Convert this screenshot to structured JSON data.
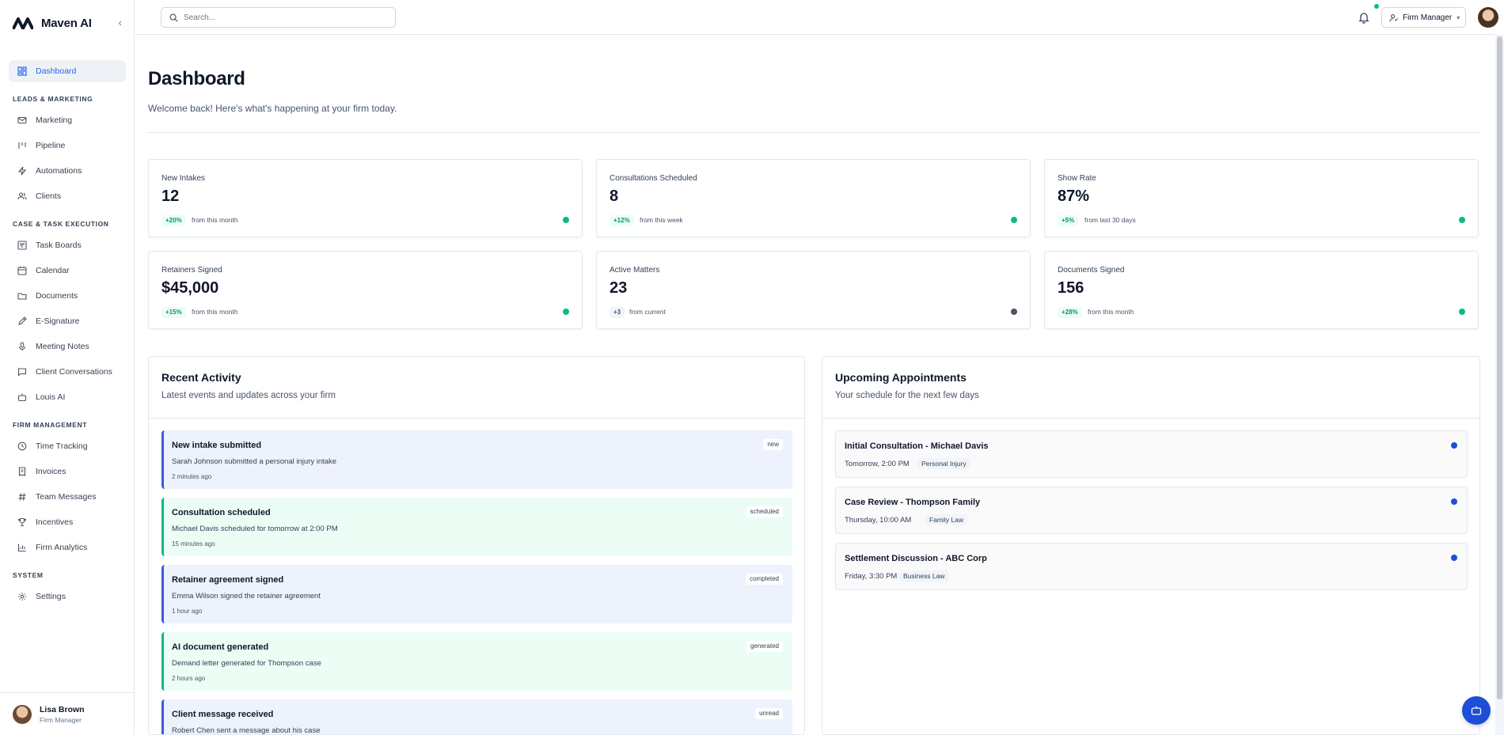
{
  "brand": {
    "name": "Maven AI",
    "collapse_icon": "chevron-left-icon"
  },
  "sidebar": {
    "dashboard": {
      "label": "Dashboard",
      "icon": "layout-grid-icon"
    },
    "sections": [
      {
        "title": "LEADS & MARKETING",
        "items": [
          {
            "label": "Marketing",
            "icon": "mail-icon"
          },
          {
            "label": "Pipeline",
            "icon": "pipeline-icon"
          },
          {
            "label": "Automations",
            "icon": "zap-icon"
          },
          {
            "label": "Clients",
            "icon": "users-icon"
          }
        ]
      },
      {
        "title": "CASE & TASK EXECUTION",
        "items": [
          {
            "label": "Task Boards",
            "icon": "kanban-icon"
          },
          {
            "label": "Calendar",
            "icon": "calendar-icon"
          },
          {
            "label": "Documents",
            "icon": "folder-icon"
          },
          {
            "label": "E-Signature",
            "icon": "pen-icon"
          },
          {
            "label": "Meeting Notes",
            "icon": "mic-icon"
          },
          {
            "label": "Client Conversations",
            "icon": "message-icon"
          },
          {
            "label": "Louis AI",
            "icon": "bot-icon"
          }
        ]
      },
      {
        "title": "FIRM MANAGEMENT",
        "items": [
          {
            "label": "Time Tracking",
            "icon": "clock-icon"
          },
          {
            "label": "Invoices",
            "icon": "receipt-icon"
          },
          {
            "label": "Team Messages",
            "icon": "hash-icon"
          },
          {
            "label": "Incentives",
            "icon": "trophy-icon"
          },
          {
            "label": "Firm Analytics",
            "icon": "bar-chart-icon"
          }
        ]
      },
      {
        "title": "SYSTEM",
        "items": [
          {
            "label": "Settings",
            "icon": "gear-icon"
          }
        ]
      }
    ],
    "user": {
      "name": "Lisa Brown",
      "role": "Firm Manager"
    }
  },
  "topbar": {
    "search": {
      "placeholder": "Search..."
    },
    "role_label": "Firm Manager"
  },
  "dashboard": {
    "title": "Dashboard",
    "subtitle": "Welcome back! Here's what's happening at your firm today.",
    "stats": [
      {
        "label": "New Intakes",
        "value": "12",
        "change": "+20%",
        "period": "from this month",
        "status": "positive"
      },
      {
        "label": "Consultations Scheduled",
        "value": "8",
        "change": "+12%",
        "period": "from this week",
        "status": "positive"
      },
      {
        "label": "Show Rate",
        "value": "87%",
        "change": "+5%",
        "period": "from last 30 days",
        "status": "positive"
      },
      {
        "label": "Retainers Signed",
        "value": "$45,000",
        "change": "+15%",
        "period": "from this month",
        "status": "positive"
      },
      {
        "label": "Active Matters",
        "value": "23",
        "change": "+3",
        "period": "from current",
        "status": "neutral"
      },
      {
        "label": "Documents Signed",
        "value": "156",
        "change": "+28%",
        "period": "from this month",
        "status": "positive"
      }
    ],
    "activity": {
      "title": "Recent Activity",
      "subtitle": "Latest events and updates across your firm",
      "items": [
        {
          "title": "New intake submitted",
          "desc": "Sarah Johnson submitted a personal injury intake",
          "time": "2 minutes ago",
          "tag": "new",
          "accent": "#3b5bdb"
        },
        {
          "title": "Consultation scheduled",
          "desc": "Michael Davis scheduled for tomorrow at 2:00 PM",
          "time": "15 minutes ago",
          "tag": "scheduled",
          "accent": "#10b981"
        },
        {
          "title": "Retainer agreement signed",
          "desc": "Emma Wilson signed the retainer agreement",
          "time": "1 hour ago",
          "tag": "completed",
          "accent": "#3b5bdb"
        },
        {
          "title": "AI document generated",
          "desc": "Demand letter generated for Thompson case",
          "time": "2 hours ago",
          "tag": "generated",
          "accent": "#10b981"
        },
        {
          "title": "Client message received",
          "desc": "Robert Chen sent a message about his case",
          "time": "",
          "tag": "unread",
          "accent": "#3b5bdb"
        }
      ]
    },
    "appointments": {
      "title": "Upcoming Appointments",
      "subtitle": "Your schedule for the next few days",
      "items": [
        {
          "title": "Initial Consultation - Michael Davis",
          "when": "Tomorrow, 2:00 PM",
          "type": "Personal Injury"
        },
        {
          "title": "Case Review - Thompson Family",
          "when": "Thursday, 10:00 AM",
          "type": "Family Law"
        },
        {
          "title": "Settlement Discussion - ABC Corp",
          "when": "Friday, 3:30 PM",
          "type": "Business Law"
        }
      ]
    }
  }
}
